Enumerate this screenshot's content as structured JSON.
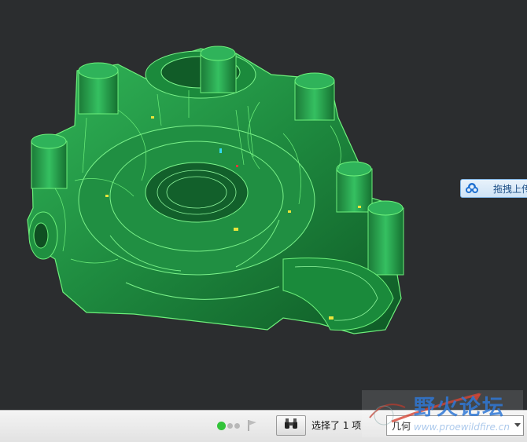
{
  "viewport": {
    "background": "#2b2d2f",
    "model": {
      "shade": "#1f8f3f",
      "edges": "#6df07b"
    }
  },
  "upload_widget": {
    "label": "拖拽上传",
    "icon": "cloud-icon"
  },
  "statusbar": {
    "lights_icon": "status-lights-icon",
    "flag_icon": "flag-icon",
    "find_icon": "binoculars-icon",
    "selection_text": "选择了 1 项",
    "filter_value": "几何"
  },
  "watermark": {
    "title": "野火论坛",
    "url": "www.proewildfire.cn"
  }
}
